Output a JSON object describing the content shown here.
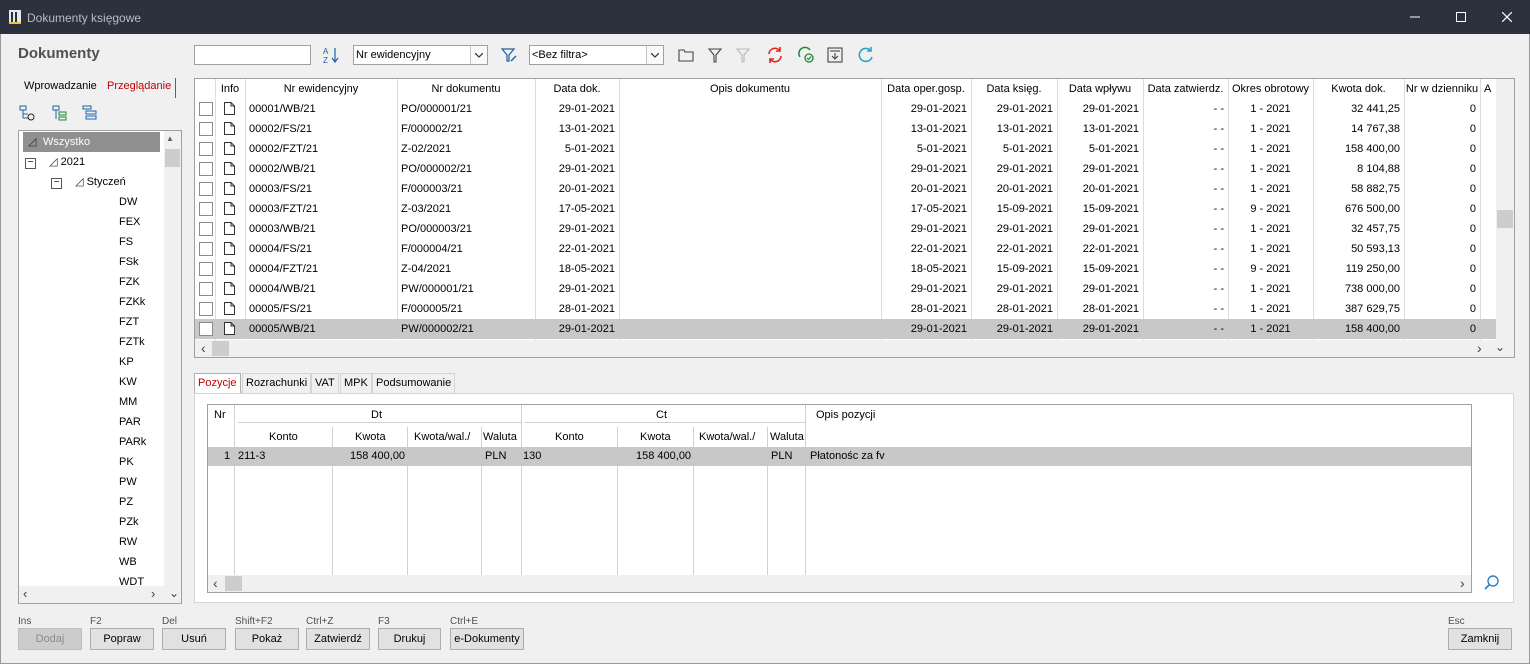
{
  "window": {
    "title": "Dokumenty księgowe"
  },
  "heading": "Dokumenty",
  "toolbar": {
    "search_value": "",
    "sort_field": "Nr ewidencyjny",
    "filter_value": "<Bez filtra>"
  },
  "left_tabs": [
    "Wprowadzanie",
    "Przeglądanie"
  ],
  "tree": {
    "root": "Wszystko",
    "year": "2021",
    "month": "Styczeń",
    "types": [
      "DW",
      "FEX",
      "FS",
      "FSk",
      "FZK",
      "FZKk",
      "FZT",
      "FZTk",
      "KP",
      "KW",
      "MM",
      "PAR",
      "PARk",
      "PK",
      "PW",
      "PZ",
      "PZk",
      "RW",
      "WB",
      "WDT"
    ]
  },
  "grid": {
    "columns": [
      "Info",
      "Nr ewidencyjny",
      "Nr dokumentu",
      "Data dok.",
      "Opis dokumentu",
      "Data oper.gosp.",
      "Data księg.",
      "Data wpływu",
      "Data zatwierdz.",
      "Okres obrotowy",
      "Kwota dok.",
      "Nr w dzienniku",
      "Au"
    ],
    "rows": [
      [
        "00001/WB/21",
        "PO/000001/21",
        "29-01-2021",
        "",
        "29-01-2021",
        "29-01-2021",
        "29-01-2021",
        "-  -",
        "1 - 2021",
        "32 441,25",
        "0"
      ],
      [
        "00002/FS/21",
        "F/000002/21",
        "13-01-2021",
        "",
        "13-01-2021",
        "13-01-2021",
        "13-01-2021",
        "-  -",
        "1 - 2021",
        "14 767,38",
        "0"
      ],
      [
        "00002/FZT/21",
        "Z-02/2021",
        "5-01-2021",
        "",
        "5-01-2021",
        "5-01-2021",
        "5-01-2021",
        "-  -",
        "1 - 2021",
        "158 400,00",
        "0"
      ],
      [
        "00002/WB/21",
        "PO/000002/21",
        "29-01-2021",
        "",
        "29-01-2021",
        "29-01-2021",
        "29-01-2021",
        "-  -",
        "1 - 2021",
        "8 104,88",
        "0"
      ],
      [
        "00003/FS/21",
        "F/000003/21",
        "20-01-2021",
        "",
        "20-01-2021",
        "20-01-2021",
        "20-01-2021",
        "-  -",
        "1 - 2021",
        "58 882,75",
        "0"
      ],
      [
        "00003/FZT/21",
        "Z-03/2021",
        "17-05-2021",
        "",
        "17-05-2021",
        "15-09-2021",
        "15-09-2021",
        "-  -",
        "9 - 2021",
        "676 500,00",
        "0"
      ],
      [
        "00003/WB/21",
        "PO/000003/21",
        "29-01-2021",
        "",
        "29-01-2021",
        "29-01-2021",
        "29-01-2021",
        "-  -",
        "1 - 2021",
        "32 457,75",
        "0"
      ],
      [
        "00004/FS/21",
        "F/000004/21",
        "22-01-2021",
        "",
        "22-01-2021",
        "22-01-2021",
        "22-01-2021",
        "-  -",
        "1 - 2021",
        "50 593,13",
        "0"
      ],
      [
        "00004/FZT/21",
        "Z-04/2021",
        "18-05-2021",
        "",
        "18-05-2021",
        "15-09-2021",
        "15-09-2021",
        "-  -",
        "9 - 2021",
        "119 250,00",
        "0"
      ],
      [
        "00004/WB/21",
        "PW/000001/21",
        "29-01-2021",
        "",
        "29-01-2021",
        "29-01-2021",
        "29-01-2021",
        "-  -",
        "1 - 2021",
        "738 000,00",
        "0"
      ],
      [
        "00005/FS/21",
        "F/000005/21",
        "28-01-2021",
        "",
        "28-01-2021",
        "28-01-2021",
        "28-01-2021",
        "-  -",
        "1 - 2021",
        "387 629,75",
        "0"
      ],
      [
        "00005/WB/21",
        "PW/000002/21",
        "29-01-2021",
        "",
        "29-01-2021",
        "29-01-2021",
        "29-01-2021",
        "-  -",
        "1 - 2021",
        "158 400,00",
        "0"
      ]
    ],
    "selected_row_index": 11
  },
  "bottom_tabs": [
    "Pozycje",
    "Rozrachunki",
    "VAT",
    "MPK",
    "Podsumowanie"
  ],
  "positions": {
    "headers": {
      "nr": "Nr",
      "dt": "Dt",
      "ct": "Ct",
      "opis": "Opis pozycji",
      "konto": "Konto",
      "kwota": "Kwota",
      "kwota_wal": "Kwota/wal./",
      "waluta": "Waluta"
    },
    "rows": [
      {
        "nr": "1",
        "dt_konto": "211-3",
        "dt_kwota": "158 400,00",
        "dt_kwota_wal": "",
        "dt_waluta": "PLN",
        "ct_konto": "130",
        "ct_kwota": "158 400,00",
        "ct_kwota_wal": "",
        "ct_waluta": "PLN",
        "opis": "Płatonośc za fv"
      }
    ]
  },
  "buttons": [
    {
      "key": "Ins",
      "label": "Dodaj",
      "enabled": false
    },
    {
      "key": "F2",
      "label": "Popraw",
      "enabled": true
    },
    {
      "key": "Del",
      "label": "Usuń",
      "enabled": true
    },
    {
      "key": "Shift+F2",
      "label": "Pokaż",
      "enabled": true
    },
    {
      "key": "Ctrl+Z",
      "label": "Zatwierdź",
      "enabled": true
    },
    {
      "key": "F3",
      "label": "Drukuj",
      "enabled": true
    },
    {
      "key": "Ctrl+E",
      "label": "e-Dokumenty",
      "enabled": true
    }
  ],
  "close_button": {
    "key": "Esc",
    "label": "Zamknij"
  },
  "colors": {
    "titlebar": "#2b323d",
    "active_tab": "#c00000",
    "selection": "#c8c8c8",
    "tree_selection": "#909090"
  }
}
